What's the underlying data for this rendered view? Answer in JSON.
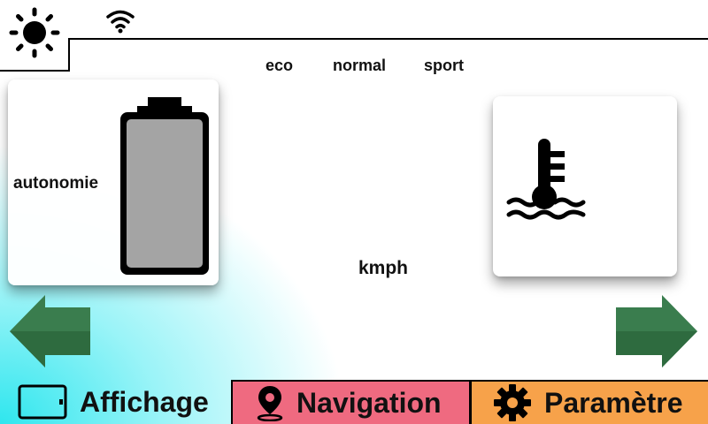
{
  "header": {
    "brightness_icon": "sun-icon",
    "wifi_icon": "wifi-icon"
  },
  "modes": {
    "eco": "eco",
    "normal": "normal",
    "sport": "sport"
  },
  "autonomy": {
    "label": "autonomie",
    "icon": "battery-icon"
  },
  "temperature": {
    "icon": "coolant-temperature-icon"
  },
  "speed": {
    "unit": "kmph"
  },
  "arrows": {
    "left_icon": "arrow-left-icon",
    "right_icon": "arrow-right-icon",
    "color": "#2e6b3f"
  },
  "tabs": [
    {
      "label": "Affichage",
      "icon": "tablet-icon",
      "color": "transparent"
    },
    {
      "label": "Navigation",
      "icon": "location-pin-icon",
      "color": "#ef6a80"
    },
    {
      "label": "Paramètre",
      "icon": "gear-icon",
      "color": "#f7a24a"
    }
  ]
}
